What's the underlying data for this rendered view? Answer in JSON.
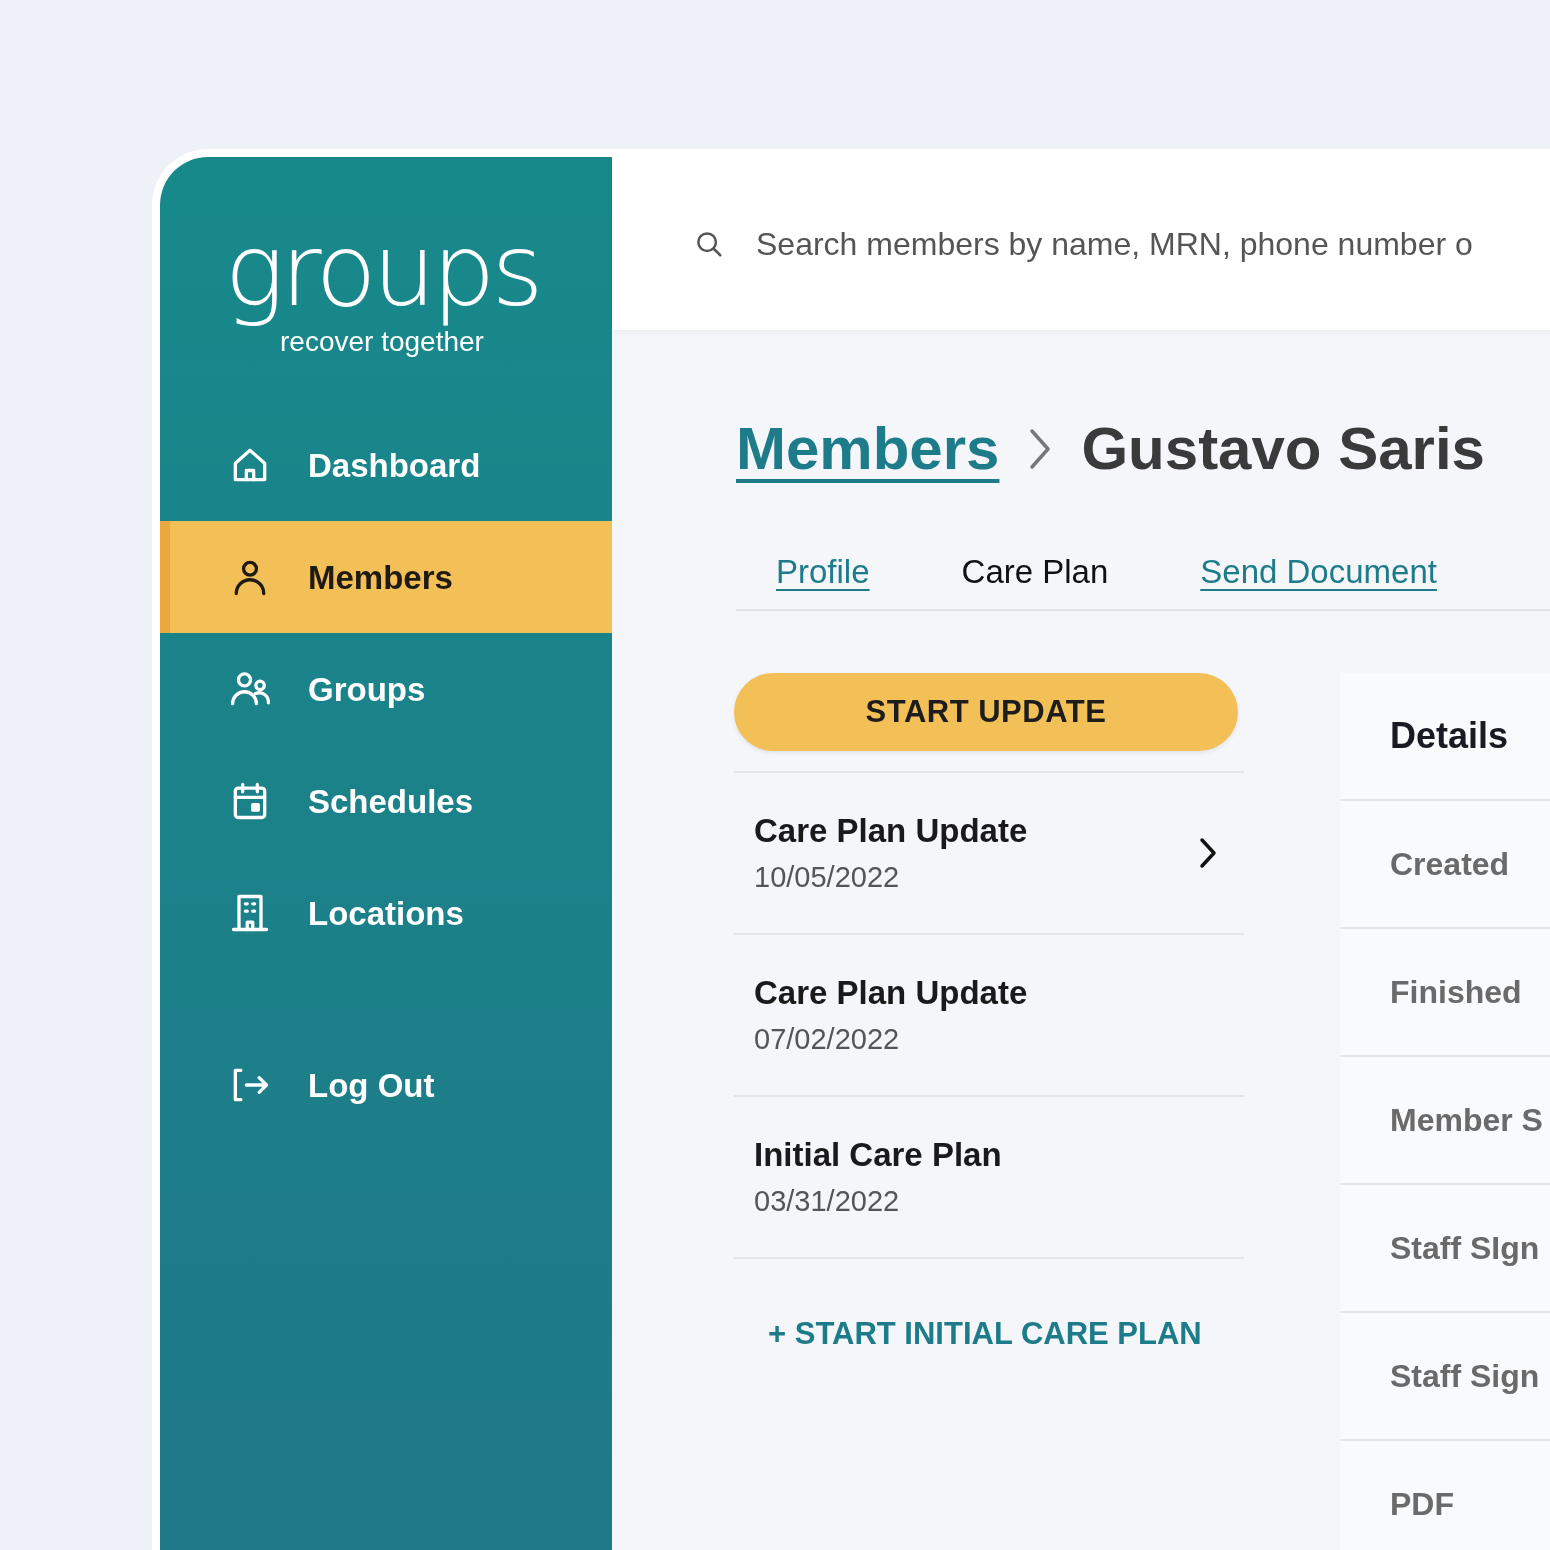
{
  "logo": {
    "wordmark": "groups",
    "tagline": "recover together"
  },
  "sidebar": {
    "items": [
      {
        "label": "Dashboard",
        "selected": false
      },
      {
        "label": "Members",
        "selected": true
      },
      {
        "label": "Groups",
        "selected": false
      },
      {
        "label": "Schedules",
        "selected": false
      },
      {
        "label": "Locations",
        "selected": false
      }
    ],
    "logout": {
      "label": "Log Out"
    }
  },
  "search": {
    "placeholder": "Search members by name, MRN, phone number o"
  },
  "breadcrumb": {
    "parent": "Members",
    "current": "Gustavo Saris"
  },
  "tabs": [
    {
      "label": "Profile",
      "selected": false
    },
    {
      "label": "Care Plan",
      "selected": true
    },
    {
      "label": "Send Document",
      "selected": false
    }
  ],
  "start_button": "START UPDATE",
  "care_plans": [
    {
      "title": "Care Plan Update",
      "date": "10/05/2022",
      "chevron": true
    },
    {
      "title": "Care Plan Update",
      "date": "07/02/2022",
      "chevron": false
    },
    {
      "title": "Initial Care Plan",
      "date": "03/31/2022",
      "chevron": false
    }
  ],
  "start_initial_link": "+ START INITIAL CARE PLAN",
  "details": {
    "title": "Details",
    "rows": [
      "Created",
      "Finished",
      "Member S",
      "Staff SIgn",
      "Staff Sign",
      "PDF"
    ]
  }
}
